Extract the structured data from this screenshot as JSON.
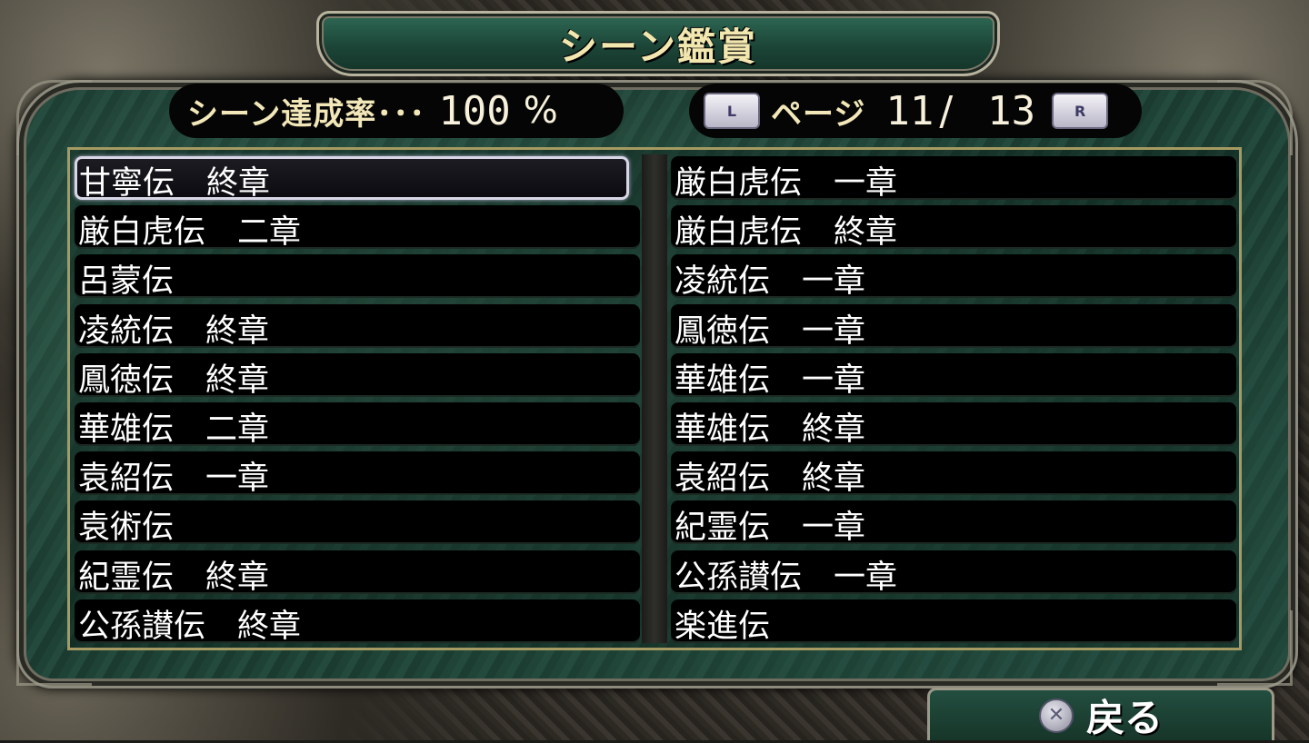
{
  "title": "シーン鑑賞",
  "completion": {
    "label": "シーン達成率･･･",
    "value": "100",
    "unit": "%"
  },
  "pagination": {
    "label": "ページ",
    "current": "11",
    "separator": "/",
    "total": "13",
    "prev_key": "L",
    "next_key": "R"
  },
  "scenes_left": [
    "甘寧伝　終章",
    "厳白虎伝　二章",
    "呂蒙伝",
    "凌統伝　終章",
    "鳳徳伝　終章",
    "華雄伝　二章",
    "袁紹伝　一章",
    "袁術伝",
    "紀霊伝　終章",
    "公孫讃伝　終章"
  ],
  "scenes_right": [
    "厳白虎伝　一章",
    "厳白虎伝　終章",
    "凌統伝　一章",
    "鳳徳伝　一章",
    "華雄伝　一章",
    "華雄伝　終章",
    "袁紹伝　終章",
    "紀霊伝　一章",
    "公孫讃伝　一章",
    "楽進伝"
  ],
  "back": {
    "button_icon": "cross-button-icon",
    "label": "戻る"
  },
  "colors": {
    "accent_text": "#f3e7b0",
    "panel": "#1f4236",
    "selection_border": "#d8d6e6"
  }
}
